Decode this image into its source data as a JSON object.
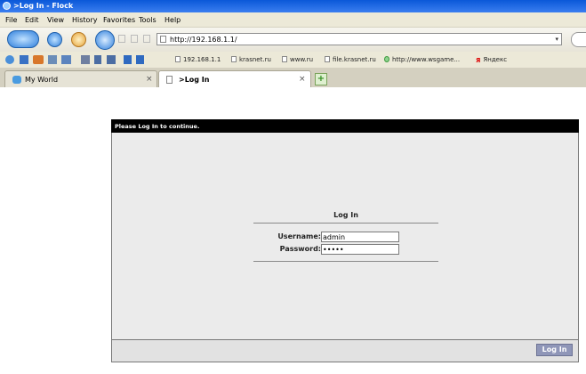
{
  "window": {
    "title": ">Log In - Flock"
  },
  "menu": [
    "File",
    "Edit",
    "View",
    "History",
    "Favorites",
    "Tools",
    "Help"
  ],
  "navbar": {
    "url": "http://192.168.1.1/"
  },
  "bookmarks": [
    "192.168.1.1",
    "krasnet.ru",
    "www.ru",
    "file.krasnet.ru",
    "http://www.wsgame...",
    "Яндекс"
  ],
  "tabs": [
    {
      "label": "My World"
    },
    {
      "label": ">Log In"
    }
  ],
  "page": {
    "banner": "Please Log In to continue.",
    "heading": "Log In",
    "username_label": "Username:",
    "username_value": "admin",
    "password_label": "Password:",
    "password_value": "*****",
    "submit_label": "Log In"
  },
  "colors": {
    "titlebar": "#0a58d8",
    "banner_bg": "#000000",
    "panel_bg": "#ebebeb",
    "button_bg": "#8f96b8"
  }
}
